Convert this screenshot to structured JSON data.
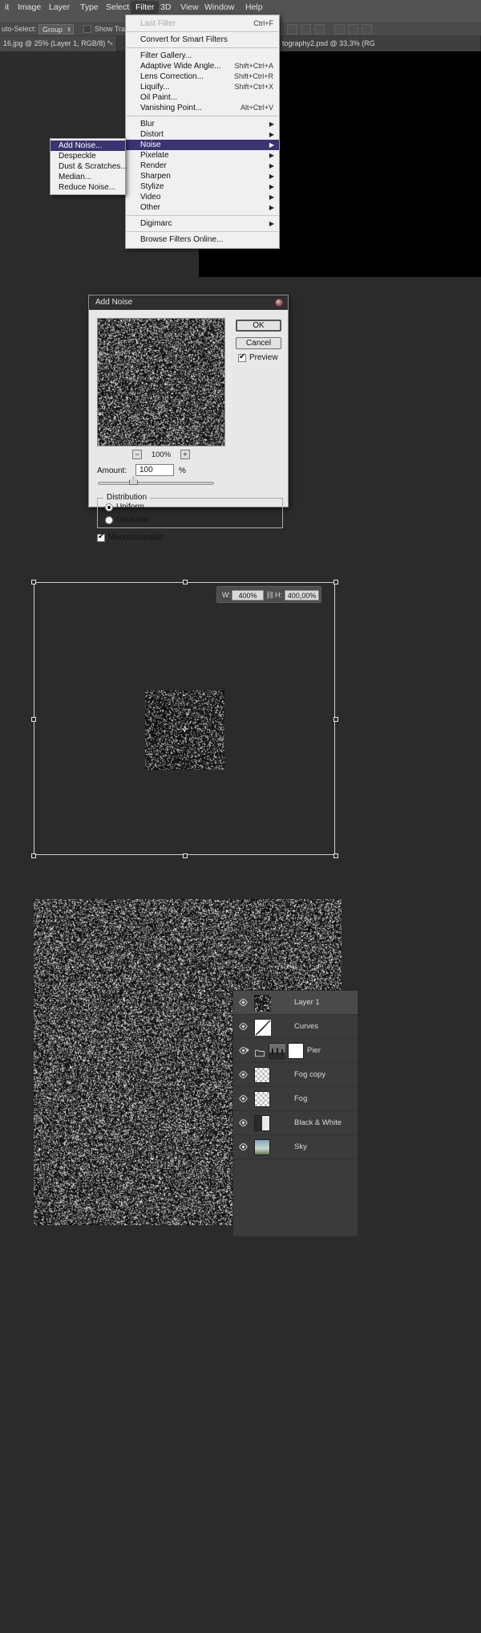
{
  "menubar": {
    "items": [
      {
        "label": "it",
        "active": false
      },
      {
        "label": "Image",
        "active": false
      },
      {
        "label": "Layer",
        "active": false
      },
      {
        "label": "Type",
        "active": false
      },
      {
        "label": "Select",
        "active": false
      },
      {
        "label": "Filter",
        "active": true
      },
      {
        "label": "3D",
        "active": false
      },
      {
        "label": "View",
        "active": false
      },
      {
        "label": "Window",
        "active": false
      },
      {
        "label": "Help",
        "active": false
      }
    ]
  },
  "optionsbar": {
    "auto_select_label": "uto-Select:",
    "group_value": "Group",
    "show_transform_label": "Show Tran"
  },
  "documenttab": {
    "title": "16.jpg @ 25% (Layer 1, RGB/8) *",
    "close": "×",
    "second_tab": "tography2.psd @ 33,3% (RG"
  },
  "filtermenu": {
    "items": [
      {
        "label": "Last Filter",
        "shortcut": "Ctrl+F",
        "disabled": true,
        "submenu": false,
        "selected": false
      },
      {
        "sep": true
      },
      {
        "label": "Convert for Smart Filters",
        "shortcut": "",
        "disabled": false,
        "submenu": false,
        "selected": false
      },
      {
        "sep": true
      },
      {
        "label": "Filter Gallery...",
        "shortcut": "",
        "disabled": false,
        "submenu": false,
        "selected": false
      },
      {
        "label": "Adaptive Wide Angle...",
        "shortcut": "Shift+Ctrl+A",
        "disabled": false,
        "submenu": false,
        "selected": false
      },
      {
        "label": "Lens Correction...",
        "shortcut": "Shift+Ctrl+R",
        "disabled": false,
        "submenu": false,
        "selected": false
      },
      {
        "label": "Liquify...",
        "shortcut": "Shift+Ctrl+X",
        "disabled": false,
        "submenu": false,
        "selected": false
      },
      {
        "label": "Oil Paint...",
        "shortcut": "",
        "disabled": false,
        "submenu": false,
        "selected": false
      },
      {
        "label": "Vanishing Point...",
        "shortcut": "Alt+Ctrl+V",
        "disabled": false,
        "submenu": false,
        "selected": false
      },
      {
        "sep": true
      },
      {
        "label": "Blur",
        "shortcut": "",
        "disabled": false,
        "submenu": true,
        "selected": false
      },
      {
        "label": "Distort",
        "shortcut": "",
        "disabled": false,
        "submenu": true,
        "selected": false
      },
      {
        "label": "Noise",
        "shortcut": "",
        "disabled": false,
        "submenu": true,
        "selected": true
      },
      {
        "label": "Pixelate",
        "shortcut": "",
        "disabled": false,
        "submenu": true,
        "selected": false
      },
      {
        "label": "Render",
        "shortcut": "",
        "disabled": false,
        "submenu": true,
        "selected": false
      },
      {
        "label": "Sharpen",
        "shortcut": "",
        "disabled": false,
        "submenu": true,
        "selected": false
      },
      {
        "label": "Stylize",
        "shortcut": "",
        "disabled": false,
        "submenu": true,
        "selected": false
      },
      {
        "label": "Video",
        "shortcut": "",
        "disabled": false,
        "submenu": true,
        "selected": false
      },
      {
        "label": "Other",
        "shortcut": "",
        "disabled": false,
        "submenu": true,
        "selected": false
      },
      {
        "sep": true
      },
      {
        "label": "Digimarc",
        "shortcut": "",
        "disabled": false,
        "submenu": true,
        "selected": false
      },
      {
        "sep": true
      },
      {
        "label": "Browse Filters Online...",
        "shortcut": "",
        "disabled": false,
        "submenu": false,
        "selected": false
      }
    ]
  },
  "noisesubmenu": {
    "items": [
      {
        "label": "Add Noise...",
        "selected": true
      },
      {
        "label": "Despeckle",
        "selected": false
      },
      {
        "label": "Dust & Scratches...",
        "selected": false
      },
      {
        "label": "Median...",
        "selected": false
      },
      {
        "label": "Reduce Noise...",
        "selected": false
      }
    ]
  },
  "dialog": {
    "title": "Add Noise",
    "ok_label": "OK",
    "cancel_label": "Cancel",
    "preview_label": "Preview",
    "preview_checked": true,
    "zoom_out": "−",
    "zoom_in": "+",
    "zoom_level": "100%",
    "amount_label": "Amount:",
    "amount_value": "100",
    "amount_unit": "%",
    "distribution_label": "Distribution",
    "uniform_label": "Uniform",
    "gaussian_label": "Gaussian",
    "distribution_selected": "Uniform",
    "monochromatic_label": "Monochromatic",
    "monochromatic_checked": true
  },
  "transform": {
    "width_label": "W:",
    "width_value": "400%",
    "link_icon": "chain-link-icon",
    "height_label": "H:",
    "height_value": "400,00%"
  },
  "layers": {
    "rows": [
      {
        "name": "Layer 1",
        "visible": true,
        "active": true,
        "type": "noise",
        "has_mask": false,
        "group": false
      },
      {
        "name": "Curves",
        "visible": true,
        "active": false,
        "type": "curves",
        "has_mask": false,
        "group": false
      },
      {
        "name": "Pier",
        "visible": true,
        "active": false,
        "type": "photo",
        "has_mask": true,
        "group": true
      },
      {
        "name": "Fog copy",
        "visible": true,
        "active": false,
        "type": "checker",
        "has_mask": false,
        "group": false
      },
      {
        "name": "Fog",
        "visible": true,
        "active": false,
        "type": "checker",
        "has_mask": false,
        "group": false
      },
      {
        "name": "Black & White",
        "visible": true,
        "active": false,
        "type": "bw",
        "has_mask": false,
        "group": false
      },
      {
        "name": "Sky",
        "visible": true,
        "active": false,
        "type": "sky",
        "has_mask": false,
        "group": false
      }
    ]
  },
  "colors": {
    "menu_bg": "#535353",
    "panel_bg": "#2b2b2b",
    "highlight": "#3b3472",
    "dialog_bg": "#e8e8e8",
    "layers_bg": "#3b3b3b"
  }
}
